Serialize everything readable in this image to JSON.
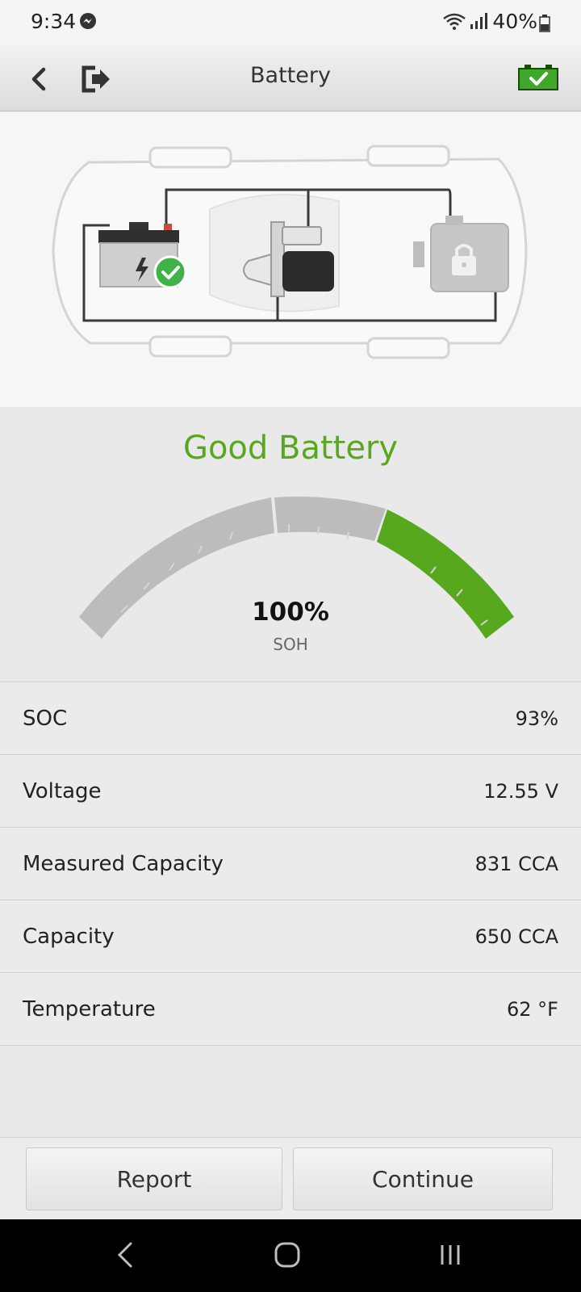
{
  "status_bar": {
    "time": "9:34",
    "battery_percent": "40%",
    "icons": [
      "messenger-icon",
      "wifi-icon",
      "signal-icon",
      "battery-icon"
    ]
  },
  "app_bar": {
    "title": "Battery",
    "icons": [
      "back-icon",
      "exit-icon",
      "battery-ok-icon"
    ]
  },
  "diagram": {
    "components": [
      "battery",
      "starter",
      "engine"
    ],
    "battery_state": "ok",
    "engine_state": "locked"
  },
  "result": {
    "status": "Good Battery",
    "soh_value": "100%",
    "soh_label": "SOH",
    "soh_percent": 100,
    "colors": {
      "good": "#58a81e",
      "inactive": "#bcbcbc"
    }
  },
  "measurements": [
    {
      "label": "SOC",
      "value": "93%"
    },
    {
      "label": "Voltage",
      "value": "12.55 V"
    },
    {
      "label": "Measured Capacity",
      "value": "831 CCA"
    },
    {
      "label": "Capacity",
      "value": "650 CCA"
    },
    {
      "label": "Temperature",
      "value": "62 °F"
    }
  ],
  "buttons": {
    "report": "Report",
    "continue": "Continue"
  },
  "nav_bar": {
    "icons": [
      "nav-back-icon",
      "nav-home-icon",
      "nav-recents-icon"
    ]
  }
}
